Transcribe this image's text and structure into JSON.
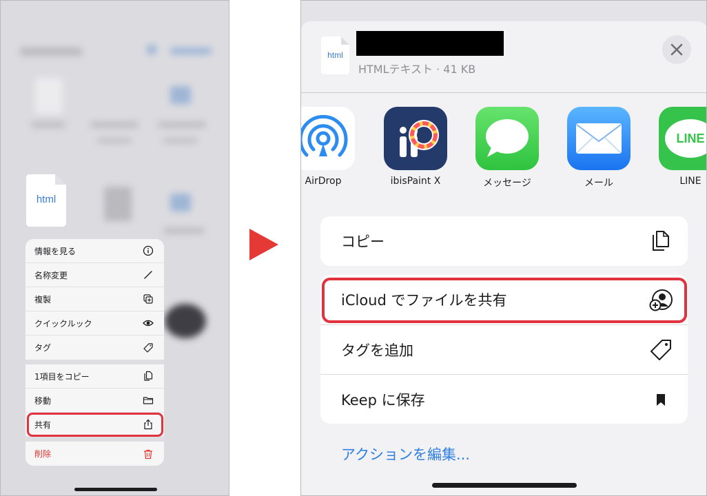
{
  "left_screen": {
    "file_thumb_label": "html",
    "menu_items": [
      {
        "label": "情報を見る",
        "icon": "info-icon"
      },
      {
        "label": "名称変更",
        "icon": "pencil-icon"
      },
      {
        "label": "複製",
        "icon": "duplicate-icon"
      },
      {
        "label": "クイックルック",
        "icon": "eye-icon"
      },
      {
        "label": "タグ",
        "icon": "tag-icon"
      },
      {
        "label": "1項目をコピー",
        "icon": "copy-icon"
      },
      {
        "label": "移動",
        "icon": "folder-icon"
      },
      {
        "label": "共有",
        "icon": "share-icon"
      },
      {
        "label": "削除",
        "icon": "trash-icon"
      }
    ],
    "highlight_color": "#e0333f",
    "danger_color": "#e5362e"
  },
  "arrow_color": "#e53935",
  "right_screen": {
    "header": {
      "file_thumb_label": "html",
      "file_subtitle": "HTMLテキスト · 41 KB"
    },
    "apps": [
      {
        "label": "AirDrop",
        "icon": "airdrop-icon"
      },
      {
        "label": "ibisPaint X",
        "icon": "ibispaint-icon"
      },
      {
        "label": "メッセージ",
        "icon": "messages-icon"
      },
      {
        "label": "メール",
        "icon": "mail-icon"
      },
      {
        "label": "LINE",
        "icon": "line-icon",
        "icon_text": "LINE"
      }
    ],
    "actions": [
      {
        "label": "コピー",
        "icon": "copy-icon"
      },
      {
        "label": "iCloud でファイルを共有",
        "icon": "person-add-icon"
      },
      {
        "label": "タグを追加",
        "icon": "tag-icon"
      },
      {
        "label": "Keep に保存",
        "icon": "bookmark-icon"
      }
    ],
    "edit_actions_label": "アクションを編集...",
    "link_color": "#2f7fe0",
    "highlight_color": "#e0333f"
  }
}
